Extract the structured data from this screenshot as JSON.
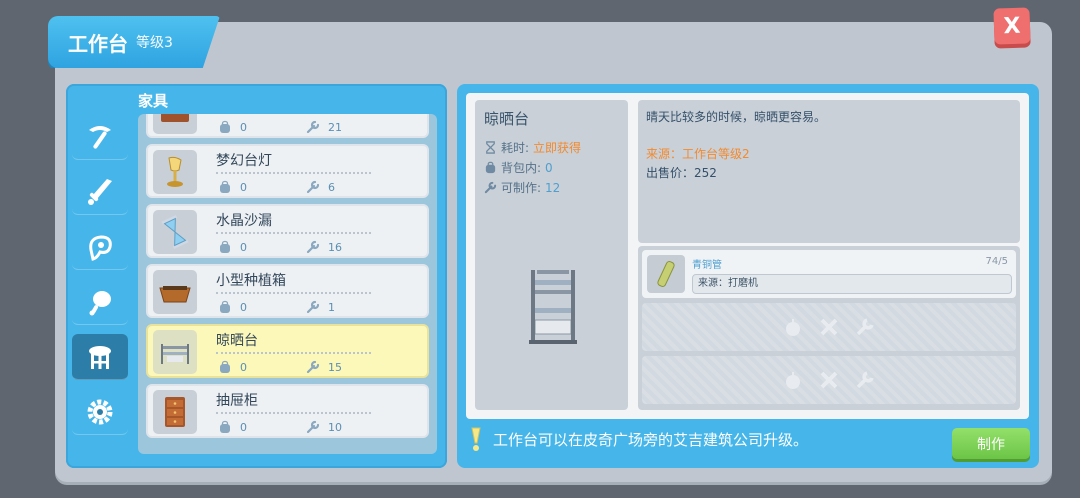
{
  "window": {
    "title": "工作台",
    "level": "等级3",
    "close_label": "X"
  },
  "category": {
    "title": "家具"
  },
  "sidebar": {
    "tabs": [
      {
        "icon": "pickaxe-icon",
        "active": false
      },
      {
        "icon": "sword-icon",
        "active": false
      },
      {
        "icon": "accessory-icon",
        "active": false
      },
      {
        "icon": "food-icon",
        "active": false
      },
      {
        "icon": "furniture-icon",
        "active": true
      },
      {
        "icon": "gear-icon",
        "active": false
      }
    ]
  },
  "items": [
    {
      "name": "",
      "bag": "0",
      "craftable": "21",
      "icon": "cabinet-icon",
      "selected": false
    },
    {
      "name": "梦幻台灯",
      "bag": "0",
      "craftable": "6",
      "icon": "lamp-icon",
      "selected": false
    },
    {
      "name": "水晶沙漏",
      "bag": "0",
      "craftable": "16",
      "icon": "hourglass-icon",
      "selected": false
    },
    {
      "name": "小型种植箱",
      "bag": "0",
      "craftable": "1",
      "icon": "planter-icon",
      "selected": false
    },
    {
      "name": "晾晒台",
      "bag": "0",
      "craftable": "15",
      "icon": "drying-rack-icon",
      "selected": true
    },
    {
      "name": "抽屉柜",
      "bag": "0",
      "craftable": "10",
      "icon": "drawer-icon",
      "selected": false
    }
  ],
  "detail": {
    "name": "晾晒台",
    "time_label": "耗时:",
    "time_value": "立即获得",
    "bag_label": "背包内:",
    "bag_value": "0",
    "craft_label": "可制作:",
    "craft_value": "12",
    "description": "晴天比较多的时候，晾晒更容易。",
    "source": "来源：工作台等级2",
    "price": "出售价：252"
  },
  "materials": [
    {
      "name": "青铜管",
      "count": "74/5",
      "source": "来源：打磨机"
    }
  ],
  "tip": "工作台可以在皮奇广场旁的艾吉建筑公司升级。",
  "make_button": "制作",
  "colors": {
    "accent": "#46b6ea",
    "selected": "#fcf8b9",
    "highlight": "#f28a2e",
    "make": "#6cc547"
  }
}
